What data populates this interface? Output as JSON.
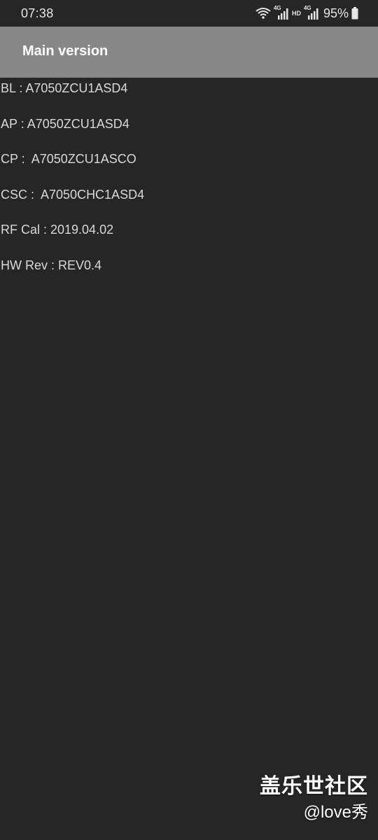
{
  "status_bar": {
    "time": "07:38",
    "network_primary": "4G",
    "hd_label": "HD",
    "network_secondary": "4G",
    "battery_percent": "95%",
    "battery_level": 0.95,
    "icons": [
      "wifi-icon",
      "signal-icon",
      "signal-icon",
      "battery-icon"
    ]
  },
  "app_bar": {
    "title": "Main version"
  },
  "info": {
    "lines": [
      "BL : A7050ZCU1ASD4",
      "AP : A7050ZCU1ASD4",
      "CP :  A7050ZCU1ASCO",
      "CSC :  A7050CHC1ASD4",
      "RF Cal : 2019.04.02",
      "HW Rev : REV0.4"
    ]
  },
  "watermark": {
    "brand": "盖乐世社区",
    "handle": "@love秀"
  },
  "colors": {
    "background": "#262626",
    "app_bar": "#878787",
    "text": "#d9d9d9"
  }
}
